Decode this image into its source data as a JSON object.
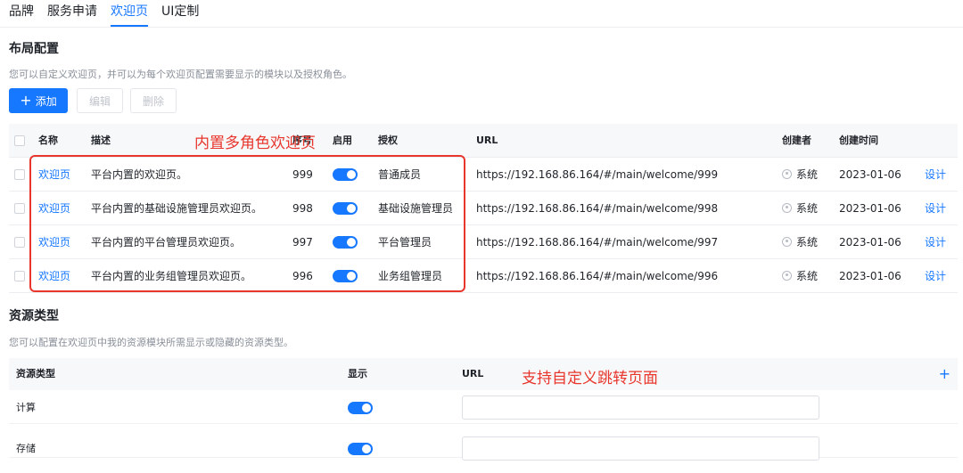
{
  "tabs": [
    "品牌",
    "服务申请",
    "欢迎页",
    "UI定制"
  ],
  "layout_section": {
    "title": "布局配置",
    "description": "您可以自定义欢迎页，并可以为每个欢迎页配置需要显示的模块以及授权角色。",
    "add_button": "添加",
    "edit_button": "编辑",
    "delete_button": "删除"
  },
  "table": {
    "columns": [
      "名称",
      "描述",
      "序号",
      "启用",
      "授权",
      "URL",
      "创建者",
      "创建时间"
    ],
    "rows": [
      {
        "name": "欢迎页",
        "desc": "平台内置的欢迎页。",
        "order": "999",
        "role": "普通成员",
        "url": "https://192.168.86.164/#/main/welcome/999",
        "creator": "系统",
        "created": "2023-01-06",
        "action": "设计"
      },
      {
        "name": "欢迎页",
        "desc": "平台内置的基础设施管理员欢迎页。",
        "order": "998",
        "role": "基础设施管理员",
        "url": "https://192.168.86.164/#/main/welcome/998",
        "creator": "系统",
        "created": "2023-01-06",
        "action": "设计"
      },
      {
        "name": "欢迎页",
        "desc": "平台内置的平台管理员欢迎页。",
        "order": "997",
        "role": "平台管理员",
        "url": "https://192.168.86.164/#/main/welcome/997",
        "creator": "系统",
        "created": "2023-01-06",
        "action": "设计"
      },
      {
        "name": "欢迎页",
        "desc": "平台内置的业务组管理员欢迎页。",
        "order": "996",
        "role": "业务组管理员",
        "url": "https://192.168.86.164/#/main/welcome/996",
        "creator": "系统",
        "created": "2023-01-06",
        "action": "设计"
      }
    ]
  },
  "annotations": {
    "multi_role": "内置多角色欢迎页",
    "custom_url": "支持自定义跳转页面"
  },
  "resource_section": {
    "title": "资源类型",
    "description": "您可以配置在欢迎页中我的资源模块所需显示或隐藏的资源类型。",
    "columns": [
      "资源类型",
      "显示",
      "URL"
    ],
    "rows": [
      {
        "type": "计算",
        "url": ""
      },
      {
        "type": "存储",
        "url": ""
      }
    ]
  },
  "colors": {
    "accent": "#1677ff",
    "annotation": "#e8362d"
  }
}
